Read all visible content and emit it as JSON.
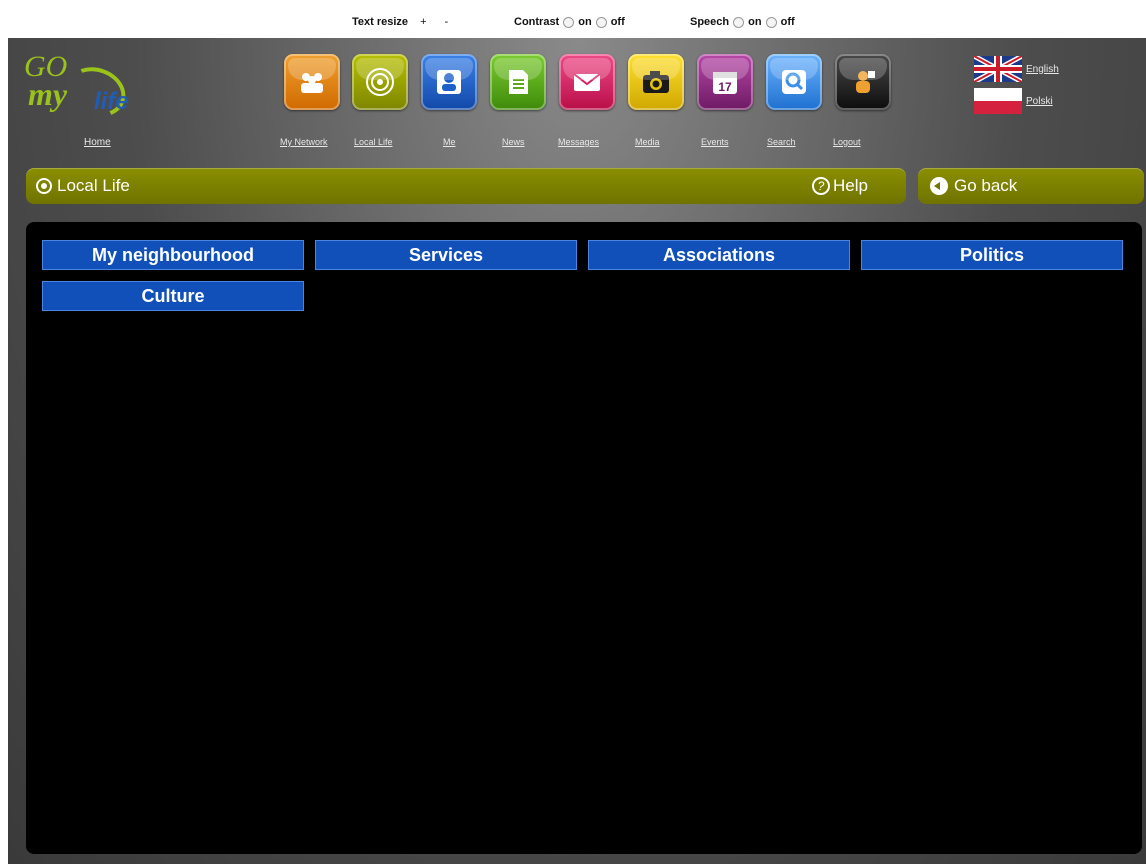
{
  "a11y": {
    "text_resize_label": "Text resize",
    "plus": "+",
    "minus": "-",
    "contrast_label": "Contrast",
    "speech_label": "Speech",
    "on": "on",
    "off": "off"
  },
  "logo": {
    "go": "GO",
    "my": "my",
    "life": "life"
  },
  "home_label": "Home",
  "nav": [
    {
      "label": "My Network",
      "icon": "people-icon",
      "color": "#e8840f"
    },
    {
      "label": "Local Life",
      "icon": "target-icon",
      "color": "#8f9a00"
    },
    {
      "label": "Me",
      "icon": "person-icon",
      "color": "#1c5fc8"
    },
    {
      "label": "News",
      "icon": "document-icon",
      "color": "#5aa81a"
    },
    {
      "label": "Messages",
      "icon": "envelope-icon",
      "color": "#d81e60"
    },
    {
      "label": "Media",
      "icon": "camera-icon",
      "color": "#e8c400"
    },
    {
      "label": "Events",
      "icon": "calendar-icon",
      "color": "#9a2a8a"
    },
    {
      "label": "Search",
      "icon": "magnifier-icon",
      "color": "#3c8fe8"
    },
    {
      "label": "Logout",
      "icon": "logout-icon",
      "color": "#1a1a1a"
    }
  ],
  "languages": [
    {
      "label": "English"
    },
    {
      "label": "Polski"
    }
  ],
  "section": {
    "title": "Local Life",
    "help": "Help",
    "go_back": "Go back"
  },
  "categories": [
    "My neighbourhood",
    "Services",
    "Associations",
    "Politics",
    "Culture"
  ]
}
